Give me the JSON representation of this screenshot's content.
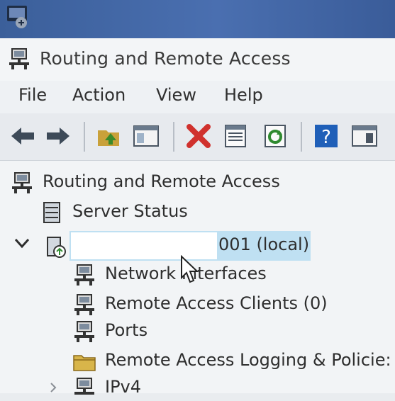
{
  "window": {
    "title": "Routing and Remote Access"
  },
  "menu": {
    "items": [
      "File",
      "Action",
      "View",
      "Help"
    ]
  },
  "toolbar": {
    "buttons": [
      {
        "icon": "back-arrow-icon"
      },
      {
        "icon": "forward-arrow-icon"
      },
      {
        "icon": "up-folder-icon"
      },
      {
        "icon": "show-hide-console-tree-icon"
      },
      {
        "icon": "delete-icon"
      },
      {
        "icon": "properties-icon"
      },
      {
        "icon": "refresh-icon"
      },
      {
        "icon": "help-icon"
      },
      {
        "icon": "action-pane-icon"
      }
    ]
  },
  "tree": {
    "root": "Routing and Remote Access",
    "server_status": "Server Status",
    "server_local_suffix": "001 (local)",
    "children": [
      "Network Interfaces",
      "Remote Access Clients (0)",
      "Ports",
      "Remote Access Logging & Policie:",
      "IPv4"
    ]
  },
  "colors": {
    "selection": "#bfe0f2",
    "delete_red": "#d0312d",
    "help_blue": "#1f5fb8"
  }
}
